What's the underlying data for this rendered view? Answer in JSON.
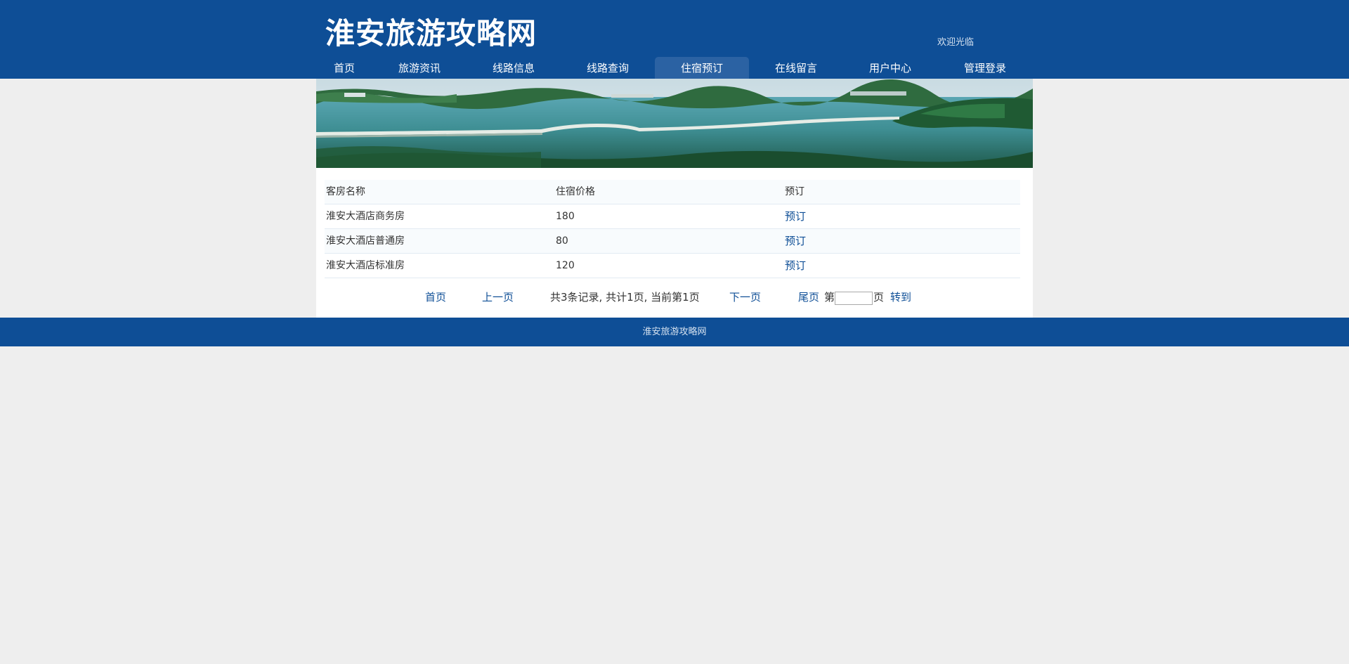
{
  "header": {
    "title": "淮安旅游攻略网",
    "welcome": "欢迎光临"
  },
  "nav": {
    "items": [
      {
        "label": "首页"
      },
      {
        "label": "旅游资讯"
      },
      {
        "label": "线路信息"
      },
      {
        "label": "线路查询"
      },
      {
        "label": "住宿预订"
      },
      {
        "label": "在线留言"
      },
      {
        "label": "用户中心"
      },
      {
        "label": "管理登录"
      }
    ],
    "active": "住宿预订"
  },
  "table": {
    "headers": [
      "客房名称",
      "住宿价格",
      "预订"
    ],
    "rows": [
      {
        "name": "淮安大酒店商务房",
        "price": "180",
        "action": "预订"
      },
      {
        "name": "淮安大酒店普通房",
        "price": "80",
        "action": "预订"
      },
      {
        "name": "淮安大酒店标准房",
        "price": "120",
        "action": "预订"
      }
    ]
  },
  "pager": {
    "first": "首页",
    "prev": "上一页",
    "summary": "共3条记录, 共计1页, 当前第1页",
    "next": "下一页",
    "last": "尾页",
    "page_prefix": "第",
    "page_input_value": "",
    "page_suffix": "页",
    "go": "转到"
  },
  "footer": {
    "text": "淮安旅游攻略网"
  },
  "colors": {
    "brand": "#0e4e96",
    "nav_active": "#2b62a3",
    "background": "#eeeeee"
  }
}
